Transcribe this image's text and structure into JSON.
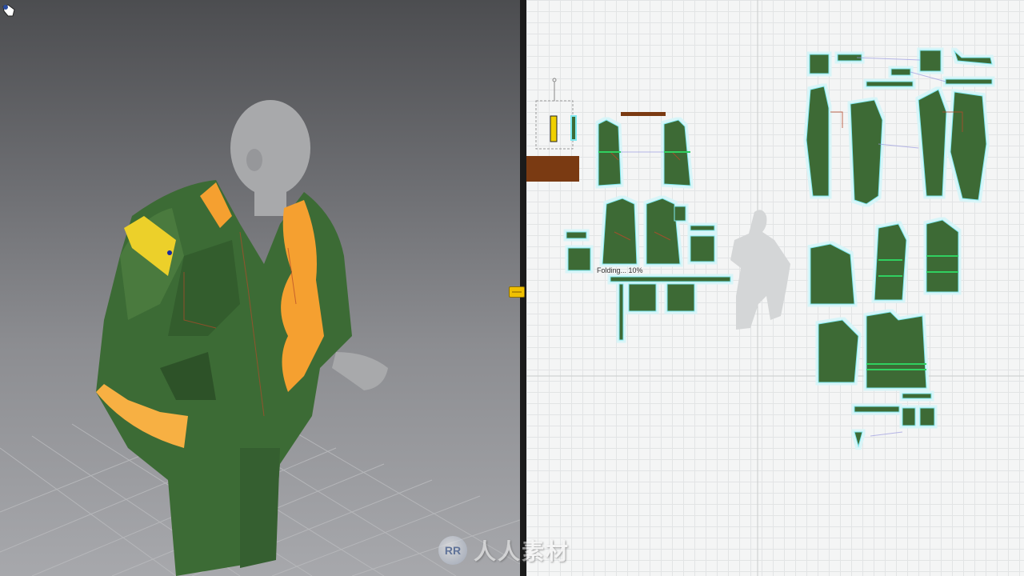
{
  "viewport_3d": {
    "label": "3D garment simulation view"
  },
  "viewport_2d": {
    "folding_status": "Folding... 10%"
  },
  "watermark": {
    "logo_text": "RR",
    "text": "人人素材"
  },
  "icons": {
    "cursor": "hand-cursor-icon",
    "splitter": "splitter-handle-icon"
  },
  "colors": {
    "fabric_green": "#3c6b35",
    "highlight_orange": "#f5a030",
    "pattern_outline": "#7fe8ef",
    "selected_piece": "#7a3a12",
    "handle_yellow": "#f0c000"
  }
}
